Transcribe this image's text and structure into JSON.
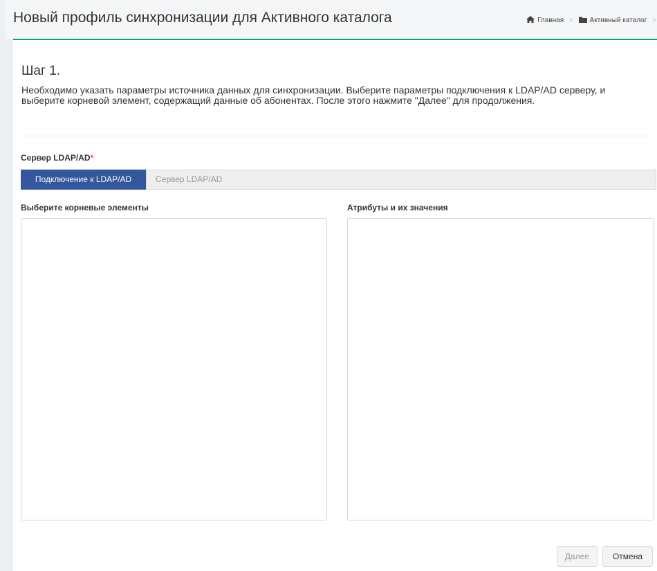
{
  "header": {
    "title": "Новый профиль синхронизации для Активного каталога",
    "breadcrumb": {
      "home": "Главная",
      "current": "Активный каталог",
      "separator": ">"
    }
  },
  "step": {
    "title": "Шаг 1.",
    "description": "Необходимо указать параметры источника данных для синхронизации. Выберите параметры подключения к LDAP/AD серверу, и выберите корневой элемент, содержащий данные об абонентах. После этого нажмите \"Далее\" для продолжения."
  },
  "server": {
    "label": "Сервер LDAP/AD",
    "required_mark": "*",
    "connect_button": "Подключение к LDAP/AD",
    "placeholder": "Сервер LDAP/AD"
  },
  "panels": {
    "root_elements_label": "Выберите корневые элементы",
    "attributes_label": "Атрибуты и их значения"
  },
  "footer": {
    "next_button": "Далее",
    "cancel_button": "Отмена"
  },
  "colors": {
    "accent_green": "#00a65a",
    "primary_button": "#34569c",
    "required": "#dd4b39"
  },
  "icons": {
    "home": "home-icon",
    "folder": "folder-icon"
  }
}
